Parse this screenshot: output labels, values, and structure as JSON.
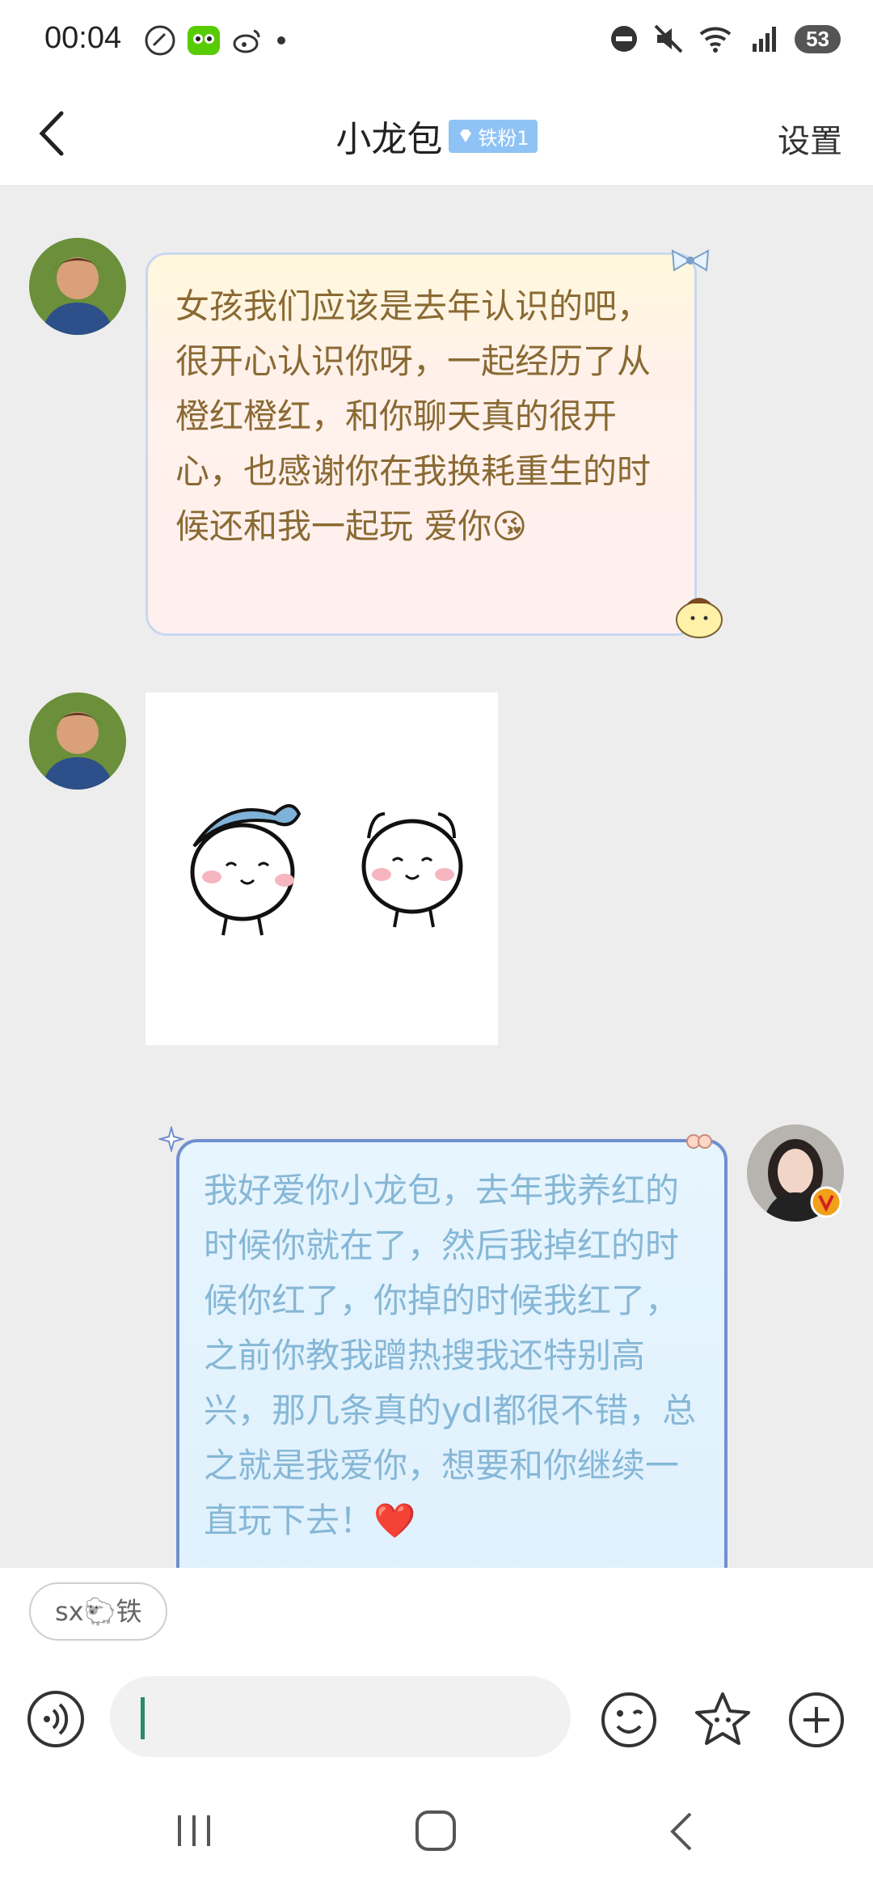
{
  "status": {
    "time": "00:04",
    "battery": "53"
  },
  "header": {
    "title": "小龙包",
    "badge": "铁粉1",
    "settings": "设置"
  },
  "messages": [
    {
      "from": "other",
      "text": "女孩我们应该是去年认识的吧，很开心认识你呀，一起经历了从橙红橙红，和你聊天真的很开心，也感谢你在我换耗重生的时候还和我一起玩 爱你😘"
    },
    {
      "from": "other",
      "type": "sticker"
    },
    {
      "from": "me",
      "text": "我好爱你小龙包，去年我养红的时候你就在了，然后我掉红的时候你红了，你掉的时候我红了，之前你教我蹭热搜我还特别高兴，那几条真的ydl都很不错，总之就是我爱你，想要和你继续一直玩下去！❤️"
    }
  ],
  "composer": {
    "chip": "sx🐑铁",
    "placeholder": ""
  },
  "colors": {
    "chat_bg": "#ededed",
    "bubble1_text": "#8a6a33",
    "bubble2_text": "#86b7d6",
    "badge_bg": "#8fc3f5"
  }
}
